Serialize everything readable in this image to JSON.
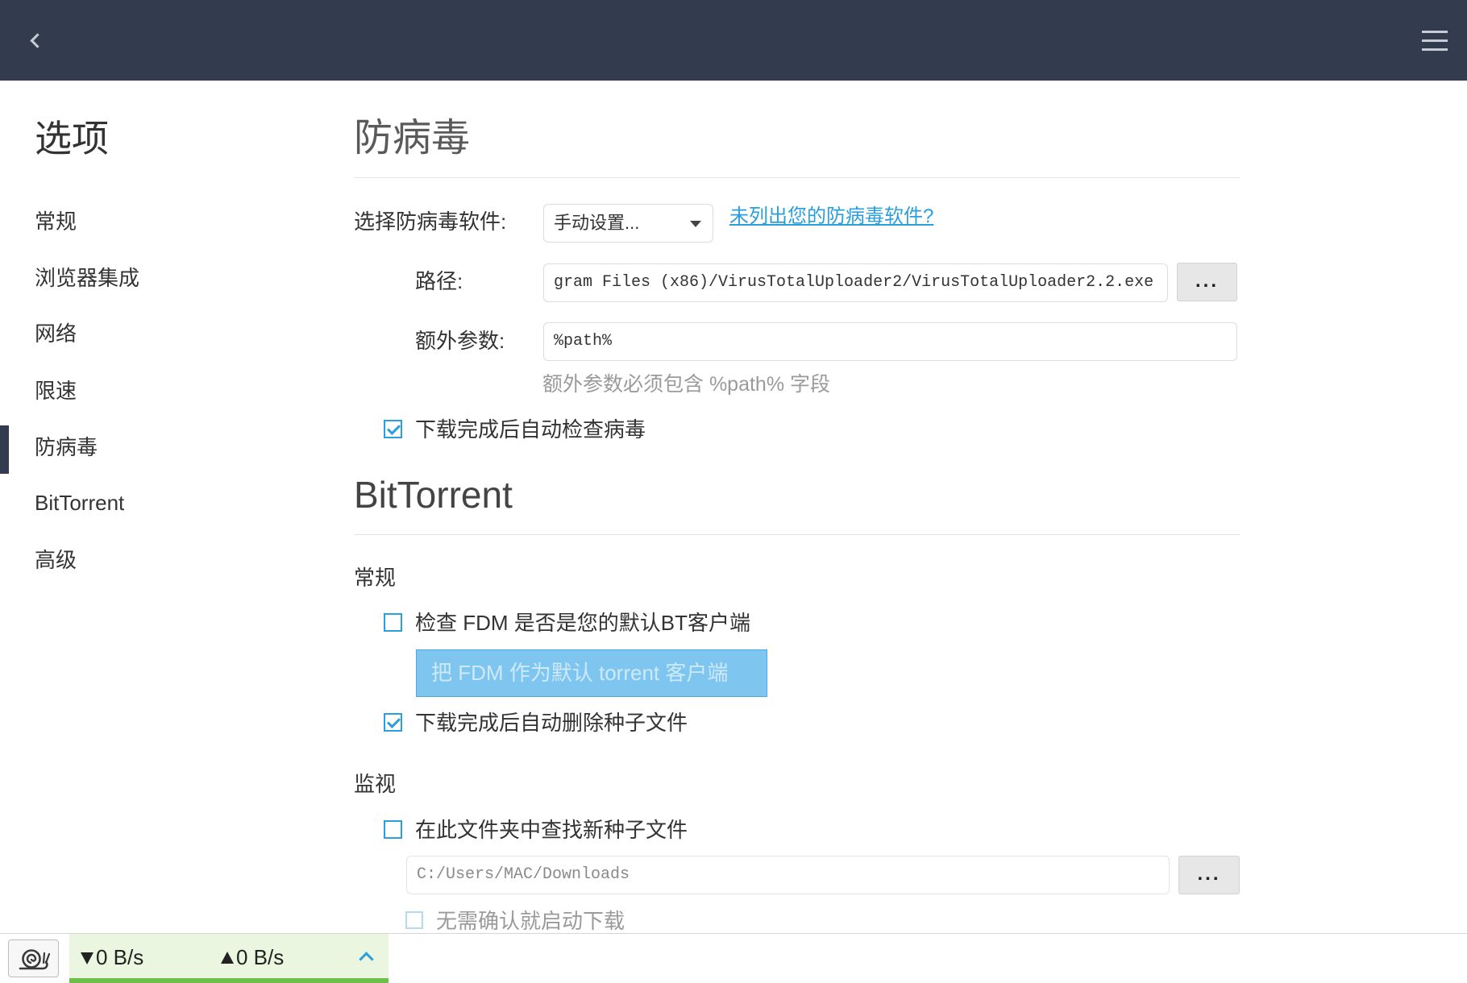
{
  "colors": {
    "header_bg": "#333b4f",
    "accent": "#2a9fdc",
    "speed_panel_bg": "#eaf6df",
    "speed_bar": "#6cc04a",
    "button_disabled_bg": "#7ec6ef"
  },
  "icons": {
    "back": "chevron-left-icon",
    "menu": "hamburger-menu-icon",
    "snail": "snail-icon",
    "download": "arrow-down-icon",
    "upload": "arrow-up-icon",
    "expand": "chevron-up-icon",
    "dropdown": "caret-down-icon"
  },
  "sidebar": {
    "title": "选项",
    "active_index": 4,
    "items": [
      {
        "label": "常规"
      },
      {
        "label": "浏览器集成"
      },
      {
        "label": "网络"
      },
      {
        "label": "限速"
      },
      {
        "label": "防病毒"
      },
      {
        "label": "BitTorrent"
      },
      {
        "label": "高级"
      }
    ]
  },
  "antivirus": {
    "heading": "防病毒",
    "software_label": "选择防病毒软件:",
    "software_value": "手动设置...",
    "not_listed_link": "未列出您的防病毒软件?",
    "path_label": "路径:",
    "path_value": "gram Files (x86)/VirusTotalUploader2/VirusTotalUploader2.2.exe",
    "browse_label": "...",
    "args_label": "额外参数:",
    "args_value": "%path%",
    "args_hint": "额外参数必须包含 %path% 字段",
    "auto_check": {
      "label": "下载完成后自动检查病毒",
      "checked": true
    }
  },
  "bittorrent": {
    "heading": "BitTorrent",
    "general_heading": "常规",
    "check_default": {
      "label": "检查 FDM 是否是您的默认BT客户端",
      "checked": false
    },
    "set_default_button": "把 FDM 作为默认 torrent 客户端",
    "auto_delete": {
      "label": "下载完成后自动删除种子文件",
      "checked": true
    },
    "monitor_heading": "监视",
    "watch_folder": {
      "label": "在此文件夹中查找新种子文件",
      "checked": false
    },
    "watch_folder_path": "C:/Users/MAC/Downloads",
    "browse_label": "...",
    "start_without_confirm": {
      "label": "无需确认就启动下载",
      "checked": false
    }
  },
  "statusbar": {
    "download_speed": "0 B/s",
    "upload_speed": "0 B/s"
  }
}
